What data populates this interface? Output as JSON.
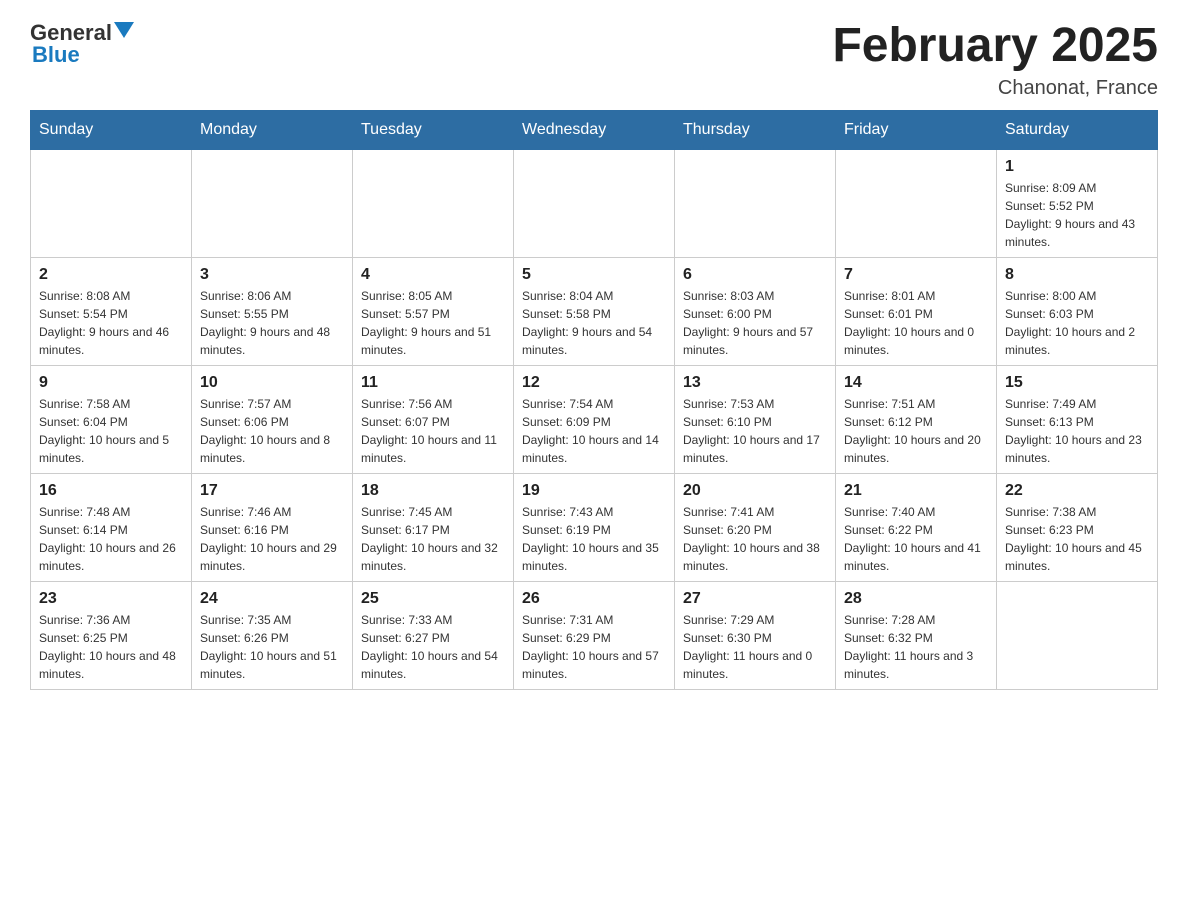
{
  "header": {
    "logo": {
      "general": "General",
      "blue": "Blue",
      "aria": "GeneralBlue logo"
    },
    "title": "February 2025",
    "location": "Chanonat, France"
  },
  "days_of_week": [
    "Sunday",
    "Monday",
    "Tuesday",
    "Wednesday",
    "Thursday",
    "Friday",
    "Saturday"
  ],
  "weeks": [
    [
      {
        "day": "",
        "info": ""
      },
      {
        "day": "",
        "info": ""
      },
      {
        "day": "",
        "info": ""
      },
      {
        "day": "",
        "info": ""
      },
      {
        "day": "",
        "info": ""
      },
      {
        "day": "",
        "info": ""
      },
      {
        "day": "1",
        "info": "Sunrise: 8:09 AM\nSunset: 5:52 PM\nDaylight: 9 hours and 43 minutes."
      }
    ],
    [
      {
        "day": "2",
        "info": "Sunrise: 8:08 AM\nSunset: 5:54 PM\nDaylight: 9 hours and 46 minutes."
      },
      {
        "day": "3",
        "info": "Sunrise: 8:06 AM\nSunset: 5:55 PM\nDaylight: 9 hours and 48 minutes."
      },
      {
        "day": "4",
        "info": "Sunrise: 8:05 AM\nSunset: 5:57 PM\nDaylight: 9 hours and 51 minutes."
      },
      {
        "day": "5",
        "info": "Sunrise: 8:04 AM\nSunset: 5:58 PM\nDaylight: 9 hours and 54 minutes."
      },
      {
        "day": "6",
        "info": "Sunrise: 8:03 AM\nSunset: 6:00 PM\nDaylight: 9 hours and 57 minutes."
      },
      {
        "day": "7",
        "info": "Sunrise: 8:01 AM\nSunset: 6:01 PM\nDaylight: 10 hours and 0 minutes."
      },
      {
        "day": "8",
        "info": "Sunrise: 8:00 AM\nSunset: 6:03 PM\nDaylight: 10 hours and 2 minutes."
      }
    ],
    [
      {
        "day": "9",
        "info": "Sunrise: 7:58 AM\nSunset: 6:04 PM\nDaylight: 10 hours and 5 minutes."
      },
      {
        "day": "10",
        "info": "Sunrise: 7:57 AM\nSunset: 6:06 PM\nDaylight: 10 hours and 8 minutes."
      },
      {
        "day": "11",
        "info": "Sunrise: 7:56 AM\nSunset: 6:07 PM\nDaylight: 10 hours and 11 minutes."
      },
      {
        "day": "12",
        "info": "Sunrise: 7:54 AM\nSunset: 6:09 PM\nDaylight: 10 hours and 14 minutes."
      },
      {
        "day": "13",
        "info": "Sunrise: 7:53 AM\nSunset: 6:10 PM\nDaylight: 10 hours and 17 minutes."
      },
      {
        "day": "14",
        "info": "Sunrise: 7:51 AM\nSunset: 6:12 PM\nDaylight: 10 hours and 20 minutes."
      },
      {
        "day": "15",
        "info": "Sunrise: 7:49 AM\nSunset: 6:13 PM\nDaylight: 10 hours and 23 minutes."
      }
    ],
    [
      {
        "day": "16",
        "info": "Sunrise: 7:48 AM\nSunset: 6:14 PM\nDaylight: 10 hours and 26 minutes."
      },
      {
        "day": "17",
        "info": "Sunrise: 7:46 AM\nSunset: 6:16 PM\nDaylight: 10 hours and 29 minutes."
      },
      {
        "day": "18",
        "info": "Sunrise: 7:45 AM\nSunset: 6:17 PM\nDaylight: 10 hours and 32 minutes."
      },
      {
        "day": "19",
        "info": "Sunrise: 7:43 AM\nSunset: 6:19 PM\nDaylight: 10 hours and 35 minutes."
      },
      {
        "day": "20",
        "info": "Sunrise: 7:41 AM\nSunset: 6:20 PM\nDaylight: 10 hours and 38 minutes."
      },
      {
        "day": "21",
        "info": "Sunrise: 7:40 AM\nSunset: 6:22 PM\nDaylight: 10 hours and 41 minutes."
      },
      {
        "day": "22",
        "info": "Sunrise: 7:38 AM\nSunset: 6:23 PM\nDaylight: 10 hours and 45 minutes."
      }
    ],
    [
      {
        "day": "23",
        "info": "Sunrise: 7:36 AM\nSunset: 6:25 PM\nDaylight: 10 hours and 48 minutes."
      },
      {
        "day": "24",
        "info": "Sunrise: 7:35 AM\nSunset: 6:26 PM\nDaylight: 10 hours and 51 minutes."
      },
      {
        "day": "25",
        "info": "Sunrise: 7:33 AM\nSunset: 6:27 PM\nDaylight: 10 hours and 54 minutes."
      },
      {
        "day": "26",
        "info": "Sunrise: 7:31 AM\nSunset: 6:29 PM\nDaylight: 10 hours and 57 minutes."
      },
      {
        "day": "27",
        "info": "Sunrise: 7:29 AM\nSunset: 6:30 PM\nDaylight: 11 hours and 0 minutes."
      },
      {
        "day": "28",
        "info": "Sunrise: 7:28 AM\nSunset: 6:32 PM\nDaylight: 11 hours and 3 minutes."
      },
      {
        "day": "",
        "info": ""
      }
    ]
  ]
}
